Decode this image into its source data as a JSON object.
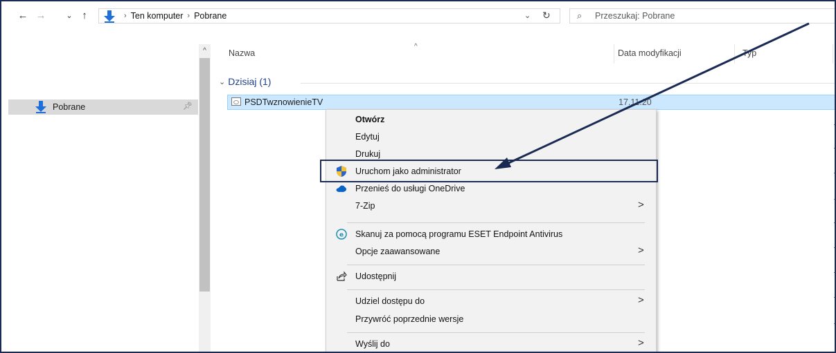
{
  "nav": {
    "back_icon": "←",
    "forward_icon": "→",
    "recent_icon": "⌄",
    "up_icon": "↑"
  },
  "address": {
    "crumbs": [
      "Ten komputer",
      "Pobrane"
    ],
    "refresh_icon": "↻"
  },
  "search": {
    "placeholder": "Przeszukaj: Pobrane"
  },
  "left_pane": {
    "items": [
      {
        "label": "Pobrane",
        "icon": "download-icon"
      }
    ]
  },
  "columns": {
    "name": "Nazwa",
    "date": "Data modyfikacji",
    "type": "Typ"
  },
  "group": {
    "label": "Dzisiaj (1)"
  },
  "file": {
    "name": "PSDTwznowienieTV",
    "date": "17.11.20"
  },
  "context_menu": {
    "items": [
      {
        "label": "Otwórz",
        "bold": true
      },
      {
        "label": "Edytuj"
      },
      {
        "label": "Drukuj"
      },
      {
        "label": "Uruchom jako administrator",
        "icon": "shield-icon"
      },
      {
        "label": "Przenieś do usługi OneDrive",
        "icon": "onedrive-cloud-icon"
      },
      {
        "label": "7-Zip",
        "submenu": true
      },
      {
        "label": "Skanuj za pomocą programu ESET Endpoint Antivirus",
        "icon": "eset-icon"
      },
      {
        "label": "Opcje zaawansowane",
        "submenu": true
      },
      {
        "label": "Udostępnij",
        "icon": "share-icon"
      },
      {
        "label": "Udziel dostępu do",
        "submenu": true
      },
      {
        "label": "Przywróć poprzednie wersje"
      },
      {
        "label": "Wyślij do",
        "submenu": true
      }
    ]
  },
  "colors": {
    "accent_blue": "#1e6fd9",
    "selection": "#cce8ff",
    "annotation": "#1a2a52"
  }
}
